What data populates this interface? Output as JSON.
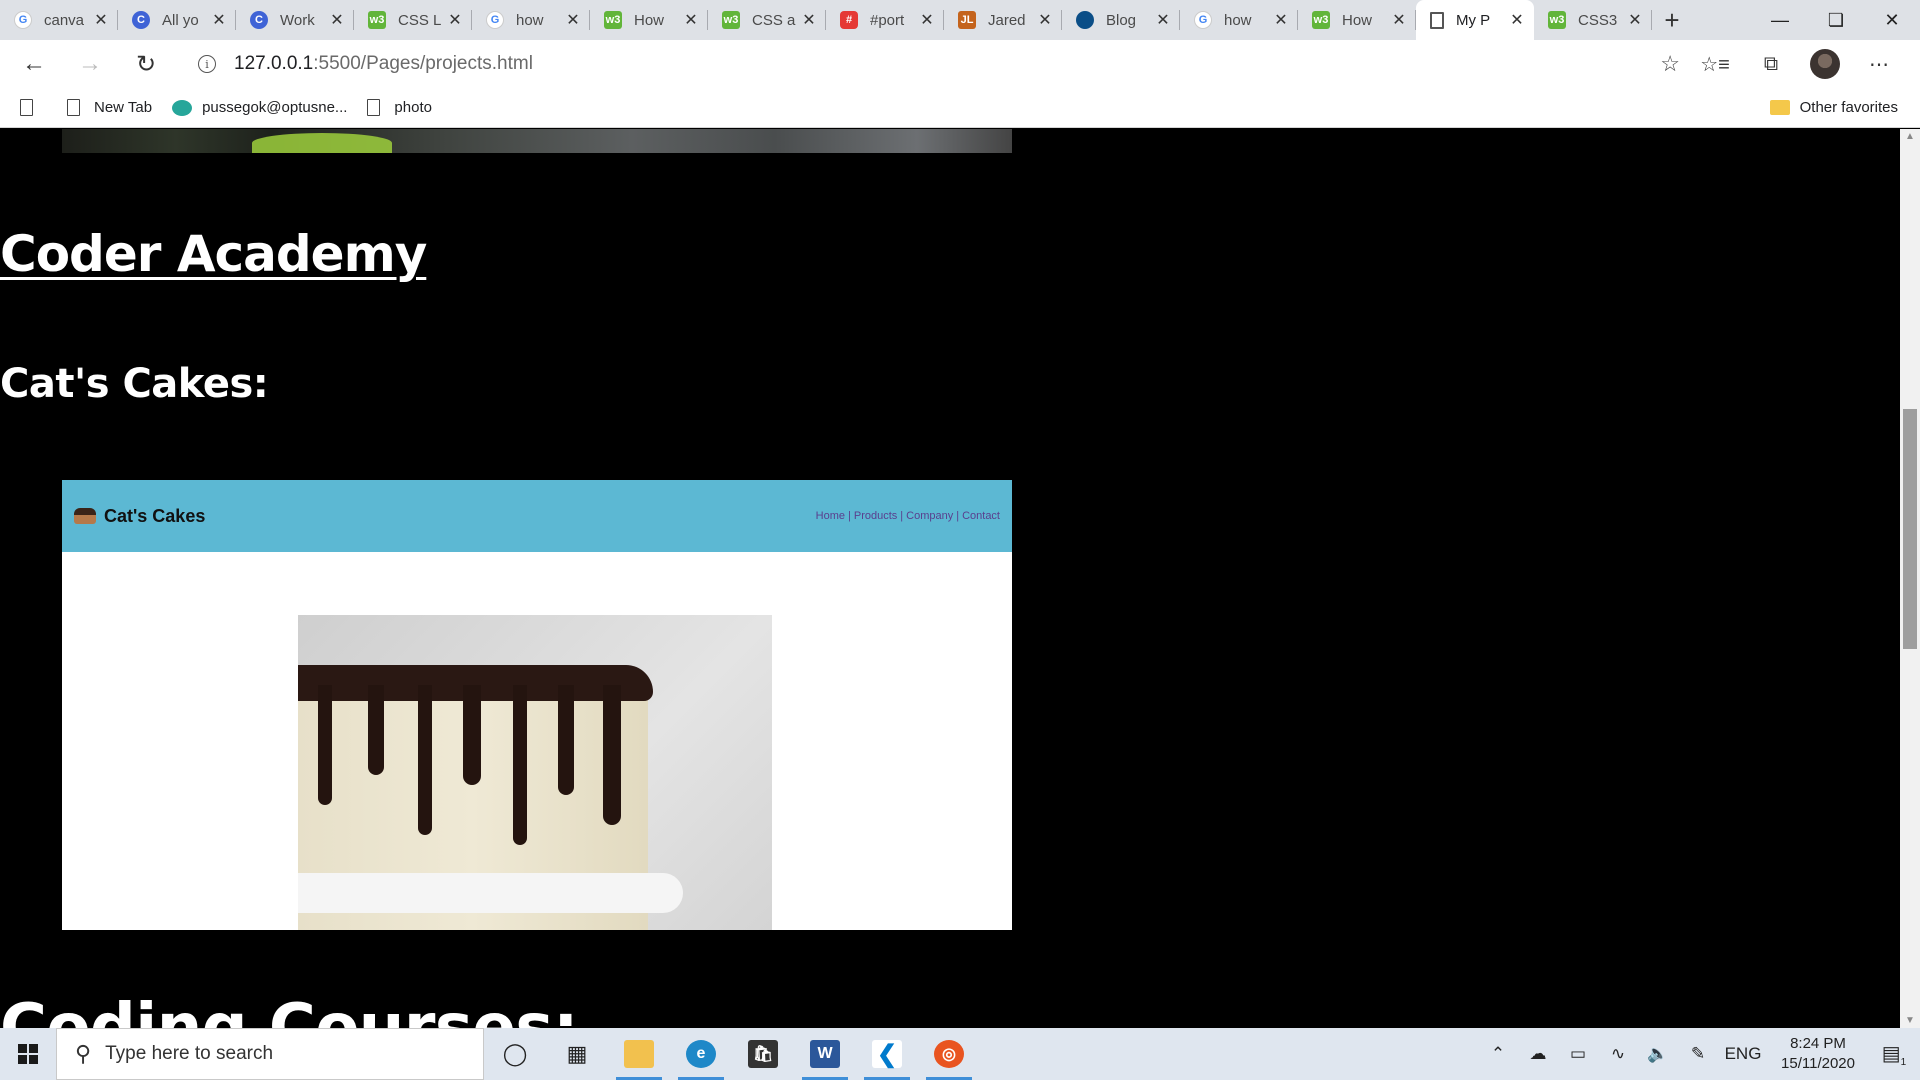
{
  "browser": {
    "tabs": [
      {
        "title": "canva",
        "icon": "google-icon",
        "active": false
      },
      {
        "title": "All yo",
        "icon": "c-icon",
        "active": false
      },
      {
        "title": "Work",
        "icon": "c-icon",
        "active": false
      },
      {
        "title": "CSS L",
        "icon": "w3schools-icon",
        "active": false
      },
      {
        "title": "how",
        "icon": "google-icon",
        "active": false
      },
      {
        "title": "How",
        "icon": "w3schools-icon",
        "active": false
      },
      {
        "title": "CSS a",
        "icon": "w3schools-icon",
        "active": false
      },
      {
        "title": "#port",
        "icon": "canva-icon",
        "active": false
      },
      {
        "title": "Jared",
        "icon": "jl-icon",
        "active": false
      },
      {
        "title": "Blog",
        "icon": "blog-icon",
        "active": false
      },
      {
        "title": "how",
        "icon": "google-icon",
        "active": false
      },
      {
        "title": "How",
        "icon": "w3schools-icon",
        "active": false
      },
      {
        "title": "My P",
        "icon": "page-icon",
        "active": true
      },
      {
        "title": "CSS3",
        "icon": "w3schools-icon",
        "active": false
      }
    ],
    "url_host": "127.0.0.1",
    "url_rest": ":5500/Pages/projects.html",
    "favorites": [
      {
        "label": "New Tab",
        "icon": "page-icon"
      },
      {
        "label": "pussegok@optusne...",
        "icon": "mail-icon"
      },
      {
        "label": "photo",
        "icon": "page-icon"
      }
    ],
    "other_favorites": "Other favorites"
  },
  "page": {
    "heading_link": "Coder Academy",
    "section_1": "Cat's Cakes:",
    "preview": {
      "brand": "Cat's Cakes",
      "nav": [
        "Home",
        "Products",
        "Company",
        "Contact"
      ],
      "header_color": "#5cb8d3"
    },
    "section_2": "Coding Courses:"
  },
  "taskbar": {
    "search_placeholder": "Type here to search",
    "apps": [
      "cortana-icon",
      "task-view-icon",
      "file-explorer-icon",
      "edge-icon",
      "store-icon",
      "word-icon",
      "vscode-icon",
      "ubuntu-icon"
    ],
    "language": "ENG",
    "time": "8:24 PM",
    "date": "15/11/2020",
    "notification_count": "1"
  }
}
